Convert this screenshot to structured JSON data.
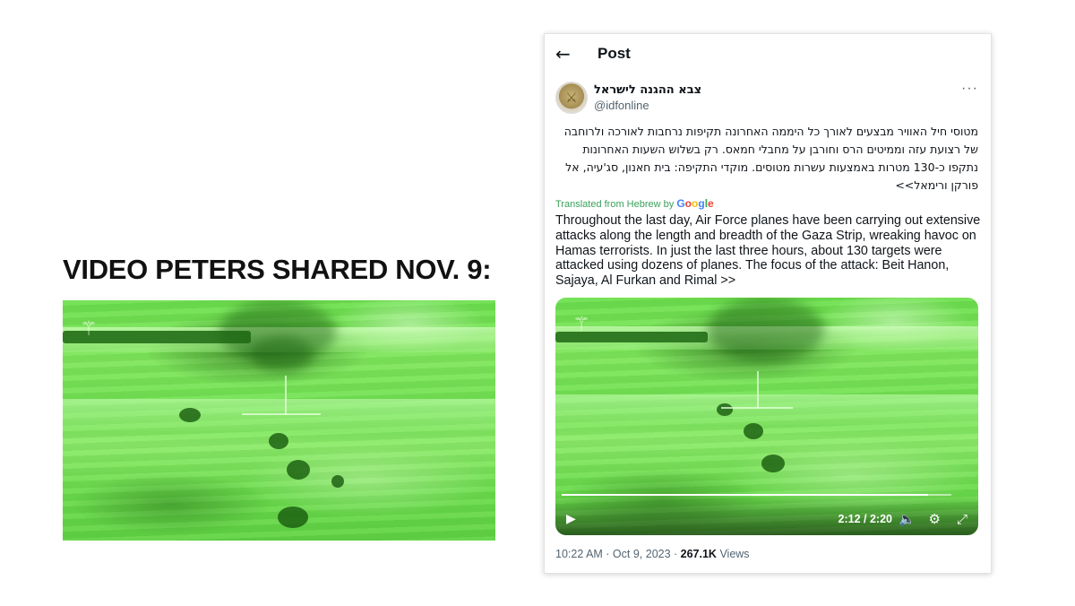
{
  "left": {
    "heading": "VIDEO PETERS SHARED NOV. 9:"
  },
  "post": {
    "header_title": "Post",
    "back_icon": "arrow-left-icon",
    "author": {
      "display_name": "צבא ההגנה לישראל",
      "handle": "@idfonline"
    },
    "more_label": "···",
    "hebrew_text": "מטוסי חיל האוויר מבצעים לאורך כל היממה האחרונה תקיפות נרחבות לאורכה ולרוחבה של רצועת עזה וממיטים הרס וחורבן על מחבלי חמאס. רק בשלוש השעות האחרונות נתקפו כ-130 מטרות באמצעות עשרות מטוסים. מוקדי התקיפה: בית חאנון, סג'עיה, אל פורקן ורימאל>>",
    "translated_prefix": "Translated from Hebrew by",
    "translated_brand": [
      "G",
      "o",
      "o",
      "g",
      "l",
      "e"
    ],
    "english_text": "Throughout the last day, Air Force planes have been carrying out extensive attacks along the length and breadth of the Gaza Strip, wreaking havoc on Hamas terrorists. In just the last three hours, about 130 targets were attacked using dozens of planes. The focus of the attack: Beit Hanon, Sajaya, Al Furkan and Rimal >>",
    "video": {
      "time_display": "2:12 / 2:20",
      "progress_fraction": 0.94
    },
    "meta": {
      "timestamp": "10:22 AM · Oct 9, 2023 · ",
      "views_count": "267.1K",
      "views_label": " Views"
    }
  },
  "icons": {
    "back": "arrow-left-icon",
    "play": "play-icon",
    "volume": "volume-icon",
    "settings": "gear-icon",
    "fullscreen": "fullscreen-icon",
    "watermark": "idf-logo-icon"
  },
  "colors": {
    "night_vision_green": "#72e253",
    "translated_green": "#3aa15b",
    "text_primary": "#0f1419",
    "text_secondary": "#536471"
  }
}
